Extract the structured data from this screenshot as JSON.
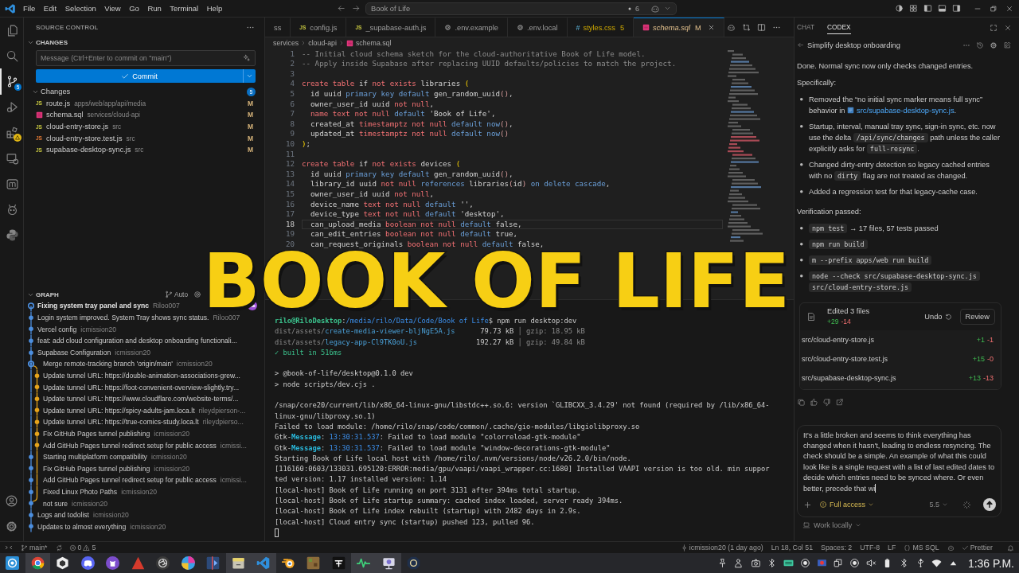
{
  "title_bar": {
    "menu": [
      "File",
      "Edit",
      "Selection",
      "View",
      "Go",
      "Run",
      "Terminal",
      "Help"
    ],
    "command_center": "Book of Life",
    "dirty_count": "6"
  },
  "activity_bar": {
    "items": [
      {
        "kind": "files",
        "selected": false,
        "warning": false
      },
      {
        "kind": "search",
        "selected": false,
        "warning": false
      },
      {
        "kind": "source-control",
        "selected": true,
        "warning": false,
        "badge": "5"
      },
      {
        "kind": "run",
        "selected": false,
        "warning": false
      },
      {
        "kind": "extensions",
        "selected": false,
        "warning": true
      },
      {
        "kind": "remote",
        "selected": false,
        "warning": false
      },
      {
        "kind": "m",
        "selected": false,
        "warning": false
      },
      {
        "kind": "robot",
        "selected": false,
        "warning": false
      },
      {
        "kind": "snake",
        "selected": false,
        "warning": false
      }
    ]
  },
  "sidebar": {
    "title": "SOURCE CONTROL",
    "repository": {
      "label": "CHANGES",
      "expanded": true
    },
    "message_placeholder": "Message (Ctrl+Enter to commit on \"main\")",
    "commit_label": "Commit",
    "changes": {
      "label": "Changes",
      "count": "5",
      "expanded": true,
      "files": [
        {
          "kind": "js",
          "icon_label": "JS",
          "name": "route.js",
          "path": "apps/web/app/api/media",
          "status": "M"
        },
        {
          "kind": "sql",
          "name": "schema.sql",
          "path": "services/cloud-api",
          "status": "M"
        },
        {
          "kind": "js",
          "icon_label": "JS",
          "name": "cloud-entry-store.js",
          "path": "src",
          "status": "M"
        },
        {
          "kind": "test",
          "icon_label": "JS",
          "name": "cloud-entry-store.test.js",
          "path": "src",
          "status": "M"
        },
        {
          "kind": "js",
          "icon_label": "JS",
          "name": "supabase-desktop-sync.js",
          "path": "src",
          "status": "M"
        }
      ]
    }
  },
  "graph": {
    "label": "GRAPH",
    "expanded": true,
    "mode": "Auto",
    "commits": [
      {
        "kind": "head",
        "color": "#4c8fe0",
        "message": "Fixing system tray panel and sync",
        "author": "Riloo007",
        "remote": true
      },
      {
        "kind": "commit",
        "color": "#4c8fe0",
        "message": "Login system improved. System Tray shows sync status.",
        "author": "Riloo007",
        "remote": false
      },
      {
        "kind": "commit",
        "color": "#4c8fe0",
        "message": "Vercel config",
        "author": "icmission20",
        "remote": false
      },
      {
        "kind": "commit",
        "color": "#4c8fe0",
        "message": "feat: add cloud configuration and desktop onboarding functionali...",
        "remote": false
      },
      {
        "kind": "commit",
        "color": "#4c8fe0",
        "message": "Supabase Configuration",
        "author": "icmission20",
        "remote": false
      },
      {
        "kind": "merge",
        "color": "#4c8fe0",
        "message": "Merge remote-tracking branch 'origin/main'",
        "author": "icmission20",
        "remote": false
      },
      {
        "kind": "branch",
        "color": "#e5a31a",
        "message": "Update tunnel URL: https://double-animation-associations-grew...",
        "remote": false
      },
      {
        "kind": "branch",
        "color": "#e5a31a",
        "message": "Update tunnel URL: https://foot-convenient-overview-slightly.try...",
        "remote": false
      },
      {
        "kind": "branch",
        "color": "#e5a31a",
        "message": "Update tunnel URL: https://www.cloudflare.com/website-terms/...",
        "remote": false
      },
      {
        "kind": "branch",
        "color": "#e5a31a",
        "message": "Update tunnel URL: https://spicy-adults-jam.loca.lt",
        "author": "rileydpierson-...",
        "remote": false
      },
      {
        "kind": "branch",
        "color": "#e5a31a",
        "message": "Update tunnel URL: https://true-comics-study.loca.lt",
        "author": "rileydpierso...",
        "remote": false
      },
      {
        "kind": "branch",
        "color": "#e5a31a",
        "message": "Fix GitHub Pages tunnel publishing",
        "author": "icmission20",
        "remote": false
      },
      {
        "kind": "branch",
        "color": "#e5a31a",
        "message": "Add GitHub Pages tunnel redirect setup for public access",
        "author": "icmissi...",
        "remote": false
      },
      {
        "kind": "parallel",
        "color": "#4c8fe0",
        "message": "Starting multiplatform compatibility",
        "author": "icmission20",
        "remote": false
      },
      {
        "kind": "parallel",
        "color": "#4c8fe0",
        "message": "Fix GitHub Pages tunnel publishing",
        "author": "icmission20",
        "remote": false
      },
      {
        "kind": "parallel",
        "color": "#4c8fe0",
        "message": "Add GitHub Pages tunnel redirect setup for public access",
        "author": "icmissi...",
        "remote": false
      },
      {
        "kind": "parallel",
        "color": "#4c8fe0",
        "message": "Fixed Linux Photo Paths",
        "author": "icmission20",
        "remote": false
      },
      {
        "kind": "fork",
        "color": "#4c8fe0",
        "message": "not sure",
        "author": "icmission20",
        "remote": false
      },
      {
        "kind": "commit",
        "color": "#4c8fe0",
        "message": "Logs and todolist",
        "author": "icmission20",
        "remote": false
      },
      {
        "kind": "commit",
        "color": "#4c8fe0",
        "message": "Updates to almost everything",
        "author": "icmission20",
        "remote": false
      }
    ]
  },
  "editor": {
    "tabs": [
      {
        "kind": "cut",
        "label": "ss",
        "warning": false,
        "modified": false,
        "preview": false,
        "selected": false
      },
      {
        "kind": "js",
        "icon_label": "JS",
        "label": "config.js",
        "warning": false,
        "modified": false,
        "preview": false,
        "selected": false
      },
      {
        "kind": "js",
        "icon_label": "JS",
        "label": "_supabase-auth.js",
        "warning": false,
        "modified": false,
        "preview": false,
        "selected": false
      },
      {
        "kind": "env",
        "label": ".env.example",
        "warning": false,
        "modified": false,
        "preview": false,
        "selected": false
      },
      {
        "kind": "env",
        "label": ".env.local",
        "warning": false,
        "modified": false,
        "preview": false,
        "selected": false
      },
      {
        "kind": "css",
        "icon_label": "#",
        "label": "styles.css",
        "suffix": "5",
        "warning": true,
        "modified": false,
        "preview": false,
        "selected": false
      },
      {
        "kind": "sql",
        "label": "schema.sql",
        "suffix": "M",
        "warning": false,
        "modified": true,
        "preview": true,
        "selected": true
      }
    ],
    "breadcrumb": [
      "services",
      "cloud-api",
      "schema.sql"
    ],
    "lines": [
      {
        "number": "1",
        "current": false,
        "tokens": [
          {
            "kind": "comment",
            "text": "-- Initial cloud schema sketch for the cloud-authoritative Book of Life model."
          }
        ]
      },
      {
        "number": "2",
        "current": false,
        "tokens": [
          {
            "kind": "comment",
            "text": "-- Apply inside Supabase after replacing UUID defaults/policies to match the project."
          }
        ]
      },
      {
        "number": "3",
        "current": false
      },
      {
        "number": "4",
        "current": false,
        "tokens": [
          {
            "kind": "keyword",
            "text": "create table"
          },
          {
            "kind": "plain",
            "text": " if "
          },
          {
            "kind": "keyword",
            "text": "not exists"
          },
          {
            "kind": "plain",
            "text": " libraries "
          },
          {
            "kind": "bracket",
            "text": "("
          }
        ]
      },
      {
        "number": "5",
        "current": false,
        "tokens": [
          {
            "kind": "plain",
            "text": "  id uuid "
          },
          {
            "kind": "builtin",
            "text": "primary key default"
          },
          {
            "kind": "plain",
            "text": " gen_random_uuid"
          },
          {
            "kind": "call",
            "text": "()"
          },
          {
            "kind": "plain",
            "text": ","
          }
        ]
      },
      {
        "number": "6",
        "current": false,
        "tokens": [
          {
            "kind": "plain",
            "text": "  owner_user_id uuid "
          },
          {
            "kind": "keyword",
            "text": "not null"
          },
          {
            "kind": "plain",
            "text": ","
          }
        ]
      },
      {
        "number": "7",
        "current": false,
        "tokens": [
          {
            "kind": "keyword",
            "text": "  name text not null"
          },
          {
            "kind": "builtin",
            "text": " default"
          },
          {
            "kind": "plain",
            "text": " 'Book of Life',"
          }
        ]
      },
      {
        "number": "8",
        "current": false,
        "tokens": [
          {
            "kind": "plain",
            "text": "  created_at "
          },
          {
            "kind": "keyword",
            "text": "timestamptz not null"
          },
          {
            "kind": "builtin",
            "text": " default now"
          },
          {
            "kind": "call",
            "text": "()"
          },
          {
            "kind": "plain",
            "text": ","
          }
        ]
      },
      {
        "number": "9",
        "current": false,
        "tokens": [
          {
            "kind": "plain",
            "text": "  updated_at "
          },
          {
            "kind": "keyword",
            "text": "timestamptz not null"
          },
          {
            "kind": "builtin",
            "text": " default now"
          },
          {
            "kind": "call",
            "text": "()"
          }
        ]
      },
      {
        "number": "10",
        "current": false,
        "tokens": [
          {
            "kind": "bracket",
            "text": ")"
          },
          {
            "kind": "plain",
            "text": ";"
          }
        ]
      },
      {
        "number": "11",
        "current": false
      },
      {
        "number": "12",
        "current": false,
        "tokens": [
          {
            "kind": "keyword",
            "text": "create table"
          },
          {
            "kind": "plain",
            "text": " if "
          },
          {
            "kind": "keyword",
            "text": "not exists"
          },
          {
            "kind": "plain",
            "text": " devices "
          },
          {
            "kind": "bracket",
            "text": "("
          }
        ]
      },
      {
        "number": "13",
        "current": false,
        "tokens": [
          {
            "kind": "plain",
            "text": "  id uuid "
          },
          {
            "kind": "builtin",
            "text": "primary key default"
          },
          {
            "kind": "plain",
            "text": " gen_random_uuid"
          },
          {
            "kind": "call",
            "text": "()"
          },
          {
            "kind": "plain",
            "text": ","
          }
        ]
      },
      {
        "number": "14",
        "current": false,
        "tokens": [
          {
            "kind": "plain",
            "text": "  library_id uuid "
          },
          {
            "kind": "keyword",
            "text": "not null"
          },
          {
            "kind": "builtin",
            "text": " references"
          },
          {
            "kind": "plain",
            "text": " libraries"
          },
          {
            "kind": "call",
            "text": "("
          },
          {
            "kind": "plain",
            "text": "id"
          },
          {
            "kind": "call",
            "text": ")"
          },
          {
            "kind": "builtin",
            "text": " on delete cascade"
          },
          {
            "kind": "plain",
            "text": ","
          }
        ]
      },
      {
        "number": "15",
        "current": false,
        "tokens": [
          {
            "kind": "plain",
            "text": "  owner_user_id uuid "
          },
          {
            "kind": "keyword",
            "text": "not null"
          },
          {
            "kind": "plain",
            "text": ","
          }
        ]
      },
      {
        "number": "16",
        "current": false,
        "tokens": [
          {
            "kind": "plain",
            "text": "  device_name "
          },
          {
            "kind": "keyword",
            "text": "text not null"
          },
          {
            "kind": "builtin",
            "text": " default"
          },
          {
            "kind": "plain",
            "text": " '',"
          }
        ]
      },
      {
        "number": "17",
        "current": false,
        "tokens": [
          {
            "kind": "plain",
            "text": "  device_type "
          },
          {
            "kind": "keyword",
            "text": "text not null"
          },
          {
            "kind": "builtin",
            "text": " default"
          },
          {
            "kind": "plain",
            "text": " 'desktop',"
          }
        ]
      },
      {
        "number": "18",
        "current": true,
        "tokens": [
          {
            "kind": "plain",
            "text": "  can_upload_media "
          },
          {
            "kind": "keyword",
            "text": "boolean not null"
          },
          {
            "kind": "builtin",
            "text": " default"
          },
          {
            "kind": "plain",
            "text": " false,"
          }
        ]
      },
      {
        "number": "19",
        "current": false,
        "tokens": [
          {
            "kind": "plain",
            "text": "  can_edit_entries "
          },
          {
            "kind": "keyword",
            "text": "boolean not null"
          },
          {
            "kind": "builtin",
            "text": " default"
          },
          {
            "kind": "plain",
            "text": " true,"
          }
        ]
      },
      {
        "number": "20",
        "current": false,
        "tokens": [
          {
            "kind": "plain",
            "text": "  can_request_originals "
          },
          {
            "kind": "keyword",
            "text": "boolean not null"
          },
          {
            "kind": "builtin",
            "text": " default"
          },
          {
            "kind": "plain",
            "text": " false,"
          }
        ]
      }
    ]
  },
  "terminal": {
    "lines": [
      {
        "kind": "output",
        "segments": [
          {
            "kind": "user",
            "text": "rilo@RiloDesktop"
          },
          {
            "kind": "plain",
            "text": ":"
          },
          {
            "kind": "path",
            "text": "/media/rilo/Data/Code/Book of Life"
          },
          {
            "kind": "plain",
            "text": "$ npm run desktop:dev"
          }
        ]
      },
      {
        "kind": "output",
        "segments": [
          {
            "kind": "dim",
            "text": "dist/assets/"
          },
          {
            "kind": "file",
            "text": "create-media-viewer-bljNgE5A.js"
          },
          {
            "kind": "plain",
            "text": "      79.73 kB "
          },
          {
            "kind": "dim",
            "text": "│ gzip: 18.95 kB"
          }
        ]
      },
      {
        "kind": "output",
        "segments": [
          {
            "kind": "dim",
            "text": "dist/assets/"
          },
          {
            "kind": "file",
            "text": "legacy-app-Cl9TK0oU.js"
          },
          {
            "kind": "plain",
            "text": "              192.27 kB "
          },
          {
            "kind": "dim",
            "text": "│ gzip: 49.84 kB"
          }
        ]
      },
      {
        "kind": "output",
        "segments": [
          {
            "kind": "ok",
            "text": "✓ built in 516ms"
          }
        ]
      },
      {
        "kind": "blank"
      },
      {
        "kind": "output",
        "segments": [
          {
            "kind": "plain",
            "text": "> @book-of-life/desktop@0.1.0 dev"
          }
        ]
      },
      {
        "kind": "output",
        "segments": [
          {
            "kind": "plain",
            "text": "> node scripts/dev.cjs ."
          }
        ]
      },
      {
        "kind": "blank"
      },
      {
        "kind": "output",
        "segments": [
          {
            "kind": "plain",
            "text": "/snap/core20/current/lib/x86_64-linux-gnu/libstdc++.so.6: version `GLIBCXX_3.4.29' not found (required by /lib/x86_64-"
          }
        ]
      },
      {
        "kind": "output",
        "segments": [
          {
            "kind": "plain",
            "text": "linux-gnu/libproxy.so.1)"
          }
        ]
      },
      {
        "kind": "output",
        "segments": [
          {
            "kind": "plain",
            "text": "Failed to load module: /home/rilo/snap/code/common/.cache/gio-modules/libgiolibproxy.so"
          }
        ]
      },
      {
        "kind": "output",
        "segments": [
          {
            "kind": "plain",
            "text": "Gtk-"
          },
          {
            "kind": "msg",
            "text": "Message"
          },
          {
            "kind": "plain",
            "text": ": "
          },
          {
            "kind": "time",
            "text": "13:30:31.537"
          },
          {
            "kind": "plain",
            "text": ": Failed to load module \"colorreload-gtk-module\""
          }
        ]
      },
      {
        "kind": "output",
        "segments": [
          {
            "kind": "plain",
            "text": "Gtk-"
          },
          {
            "kind": "msg",
            "text": "Message"
          },
          {
            "kind": "plain",
            "text": ": "
          },
          {
            "kind": "time",
            "text": "13:30:31.537"
          },
          {
            "kind": "plain",
            "text": ": Failed to load module \"window-decorations-gtk-module\""
          }
        ]
      },
      {
        "kind": "output",
        "segments": [
          {
            "kind": "plain",
            "text": "Starting Book of Life local host with /home/rilo/.nvm/versions/node/v26.2.0/bin/node."
          }
        ]
      },
      {
        "kind": "output",
        "segments": [
          {
            "kind": "plain",
            "text": "[116160:0603/133031.695120:ERROR:media/gpu/vaapi/vaapi_wrapper.cc:1680] Installed VAAPI version is too old. min suppor"
          }
        ]
      },
      {
        "kind": "output",
        "segments": [
          {
            "kind": "plain",
            "text": "ted version: 1.17 installed version: 1.14"
          }
        ]
      },
      {
        "kind": "output",
        "segments": [
          {
            "kind": "plain",
            "text": "[local-host] Book of Life running on port 3131 after 394ms total startup."
          }
        ]
      },
      {
        "kind": "output",
        "segments": [
          {
            "kind": "plain",
            "text": "[local-host] Book of Life startup summary: cached index loaded, server ready 394ms."
          }
        ]
      },
      {
        "kind": "output",
        "segments": [
          {
            "kind": "plain",
            "text": "[local-host] Book of Life index rebuilt (startup) with 2482 days in 2.9s."
          }
        ]
      },
      {
        "kind": "output",
        "segments": [
          {
            "kind": "plain",
            "text": "[local-host] Cloud entry sync (startup) pushed 123, pulled 96."
          }
        ]
      },
      {
        "kind": "cursor"
      }
    ]
  },
  "chat": {
    "tabs": [
      {
        "label": "CHAT",
        "selected": false
      },
      {
        "label": "CODEX",
        "selected": true
      }
    ],
    "thread_title": "Simplify desktop onboarding",
    "blocks": [
      {
        "kind": "paragraph",
        "parts": [
          {
            "kind": "text",
            "text": "Done. Normal sync now only checks changed entries."
          }
        ]
      },
      {
        "kind": "paragraph",
        "parts": [
          {
            "kind": "text",
            "text": "Specifically:"
          }
        ]
      },
      {
        "kind": "bullets",
        "items": [
          {
            "parts": [
              {
                "kind": "text",
                "text": "Removed the “no initial sync marker means full sync” behavior in "
              },
              {
                "kind": "link",
                "text": "src/supabase-desktop-sync.js"
              },
              {
                "kind": "text",
                "text": "."
              }
            ]
          },
          {
            "parts": [
              {
                "kind": "text",
                "text": "Startup, interval, manual tray sync, sign-in sync, etc. now use the delta "
              },
              {
                "kind": "code",
                "text": "/api/sync/changes"
              },
              {
                "kind": "text",
                "text": " path unless the caller explicitly asks for "
              },
              {
                "kind": "code",
                "text": "full-resync"
              },
              {
                "kind": "text",
                "text": "."
              }
            ]
          },
          {
            "parts": [
              {
                "kind": "text",
                "text": "Changed dirty-entry detection so legacy cached entries with no "
              },
              {
                "kind": "code",
                "text": "dirty"
              },
              {
                "kind": "text",
                "text": " flag are not treated as changed."
              }
            ]
          },
          {
            "parts": [
              {
                "kind": "text",
                "text": "Added a regression test for that legacy-cache case."
              }
            ]
          }
        ]
      },
      {
        "kind": "paragraph",
        "parts": [
          {
            "kind": "text",
            "text": "Verification passed:"
          }
        ]
      },
      {
        "kind": "bullets",
        "items": [
          {
            "parts": [
              {
                "kind": "code",
                "text": "npm test"
              },
              {
                "kind": "text",
                "text": " → 17 files, 57 tests passed"
              }
            ]
          },
          {
            "parts": [
              {
                "kind": "code",
                "text": "npm run build"
              }
            ]
          },
          {
            "parts": [
              {
                "kind": "code",
                "text": "m --prefix apps/web run build"
              }
            ]
          },
          {
            "parts": [
              {
                "kind": "code",
                "text": "node --check src/supabase-desktop-sync.js src/cloud-entry-store.js"
              }
            ]
          }
        ]
      }
    ],
    "edits": {
      "title": "Edited 3 files",
      "added": "+29",
      "removed": "-14",
      "undo": "Undo",
      "review": "Review",
      "files": [
        {
          "path": "src/cloud-entry-store.js",
          "added": "+1",
          "removed": "-1"
        },
        {
          "path": "src/cloud-entry-store.test.js",
          "added": "+15",
          "removed": "-0"
        },
        {
          "path": "src/supabase-desktop-sync.js",
          "added": "+13",
          "removed": "-13"
        }
      ]
    },
    "composer": {
      "value": "It's a little broken and seems to think everything has changed when it hasn't, leading to endless resyncing. The check should be a simple. An example of what this could look like is a single request with a list of last edited dates to decide which entries need to be synced where. Or even better, precede that wi",
      "access": "Full access",
      "model": "5.5"
    },
    "location": "Work locally"
  },
  "status_bar": {
    "branch": "main*",
    "errors": "0",
    "warnings": "5",
    "blame": "icmission20 (1 day ago)",
    "cursor": "Ln 18, Col 51",
    "indentation": "Spaces: 2",
    "encoding": "UTF-8",
    "line_ending": "LF",
    "language": "MS SQL",
    "formatter": "Prettier"
  },
  "taskbar": {
    "apps": [
      {
        "kind": "launcher",
        "open": false
      },
      {
        "kind": "tricolor",
        "open": true
      },
      {
        "kind": "hexagon",
        "open": false
      },
      {
        "kind": "bubble",
        "open": false
      },
      {
        "kind": "cat",
        "open": false
      },
      {
        "kind": "triangle",
        "open": false
      },
      {
        "kind": "aperture",
        "open": false
      },
      {
        "kind": "ball",
        "open": false
      },
      {
        "kind": "timeline",
        "open": false
      },
      {
        "kind": "cabinet",
        "open": true
      },
      {
        "kind": "ribbon",
        "open": true
      },
      {
        "kind": "swoosh",
        "open": false
      },
      {
        "kind": "block",
        "open": false
      },
      {
        "kind": "tile",
        "open": false
      },
      {
        "kind": "wave",
        "open": true
      },
      {
        "kind": "monitor",
        "open": true
      },
      {
        "kind": "octagon",
        "open": false
      }
    ],
    "clock": "1:36 P.M."
  },
  "overlay_title": "BOOK OF LIFE"
}
